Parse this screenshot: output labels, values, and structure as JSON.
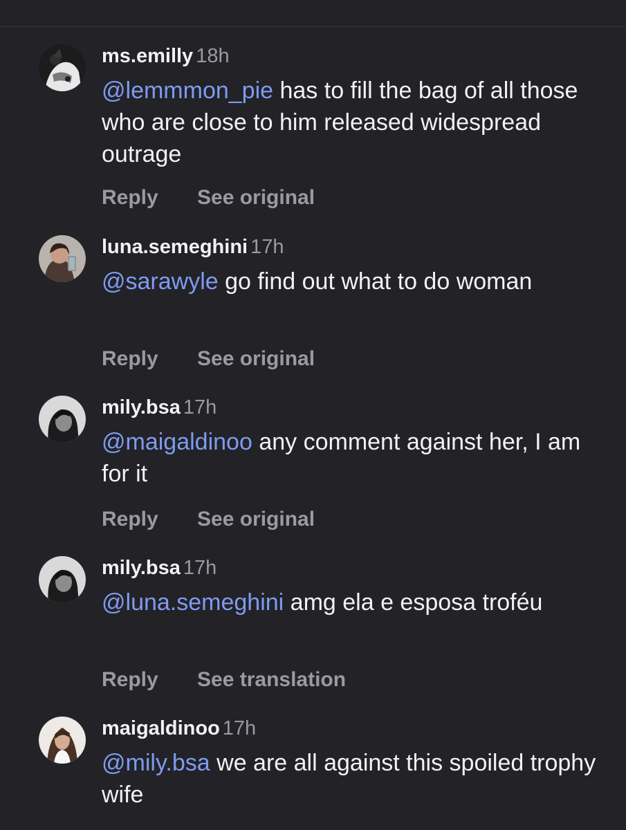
{
  "comments": [
    {
      "username": "ms.emilly",
      "time": "18h",
      "mention": "@lemmmon_pie",
      "text": " has to fill the bag of all those who are close to him released widespread outrage",
      "reply_label": "Reply",
      "action_label": "See original",
      "avatar": "dark-bw-profile-photo"
    },
    {
      "username": "luna.semeghini",
      "time": "17h",
      "mention": "@sarawyle",
      "text": " go find out what to do woman",
      "reply_label": "Reply",
      "action_label": "See original",
      "avatar": "mirror-selfie-photo"
    },
    {
      "username": "mily.bsa",
      "time": "17h",
      "mention": "@maigaldinoo",
      "text": " any comment against her, I am for it",
      "reply_label": "Reply",
      "action_label": "See original",
      "avatar": "bw-portrait-photo"
    },
    {
      "username": "mily.bsa",
      "time": "17h",
      "mention": "@luna.semeghini",
      "text": " amg ela e esposa troféu",
      "reply_label": "Reply",
      "action_label": "See translation",
      "avatar": "bw-portrait-photo"
    },
    {
      "username": "maigaldinoo",
      "time": "17h",
      "mention": "@mily.bsa",
      "text": " we are all against this spoiled trophy wife",
      "reply_label": "Reply",
      "action_label": "",
      "avatar": "light-portrait-photo"
    }
  ]
}
